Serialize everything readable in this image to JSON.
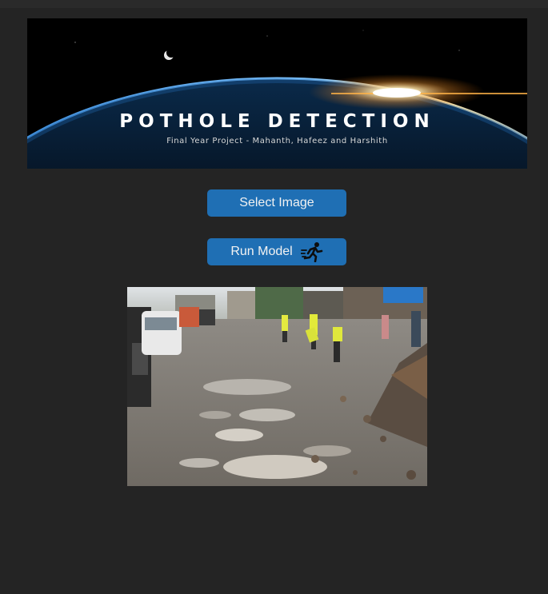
{
  "banner": {
    "title": "POTHOLE DETECTION",
    "subtitle": "Final Year Project - Mahanth, Hafeez and Harshith"
  },
  "buttons": {
    "select_label": "Select Image",
    "run_label": "Run Model",
    "run_icon": "running-person-icon"
  },
  "image": {
    "alt": "Road with potholes and workers"
  },
  "colors": {
    "background": "#242424",
    "button": "#1f6fb4",
    "button_text": "#f2f2f2"
  }
}
